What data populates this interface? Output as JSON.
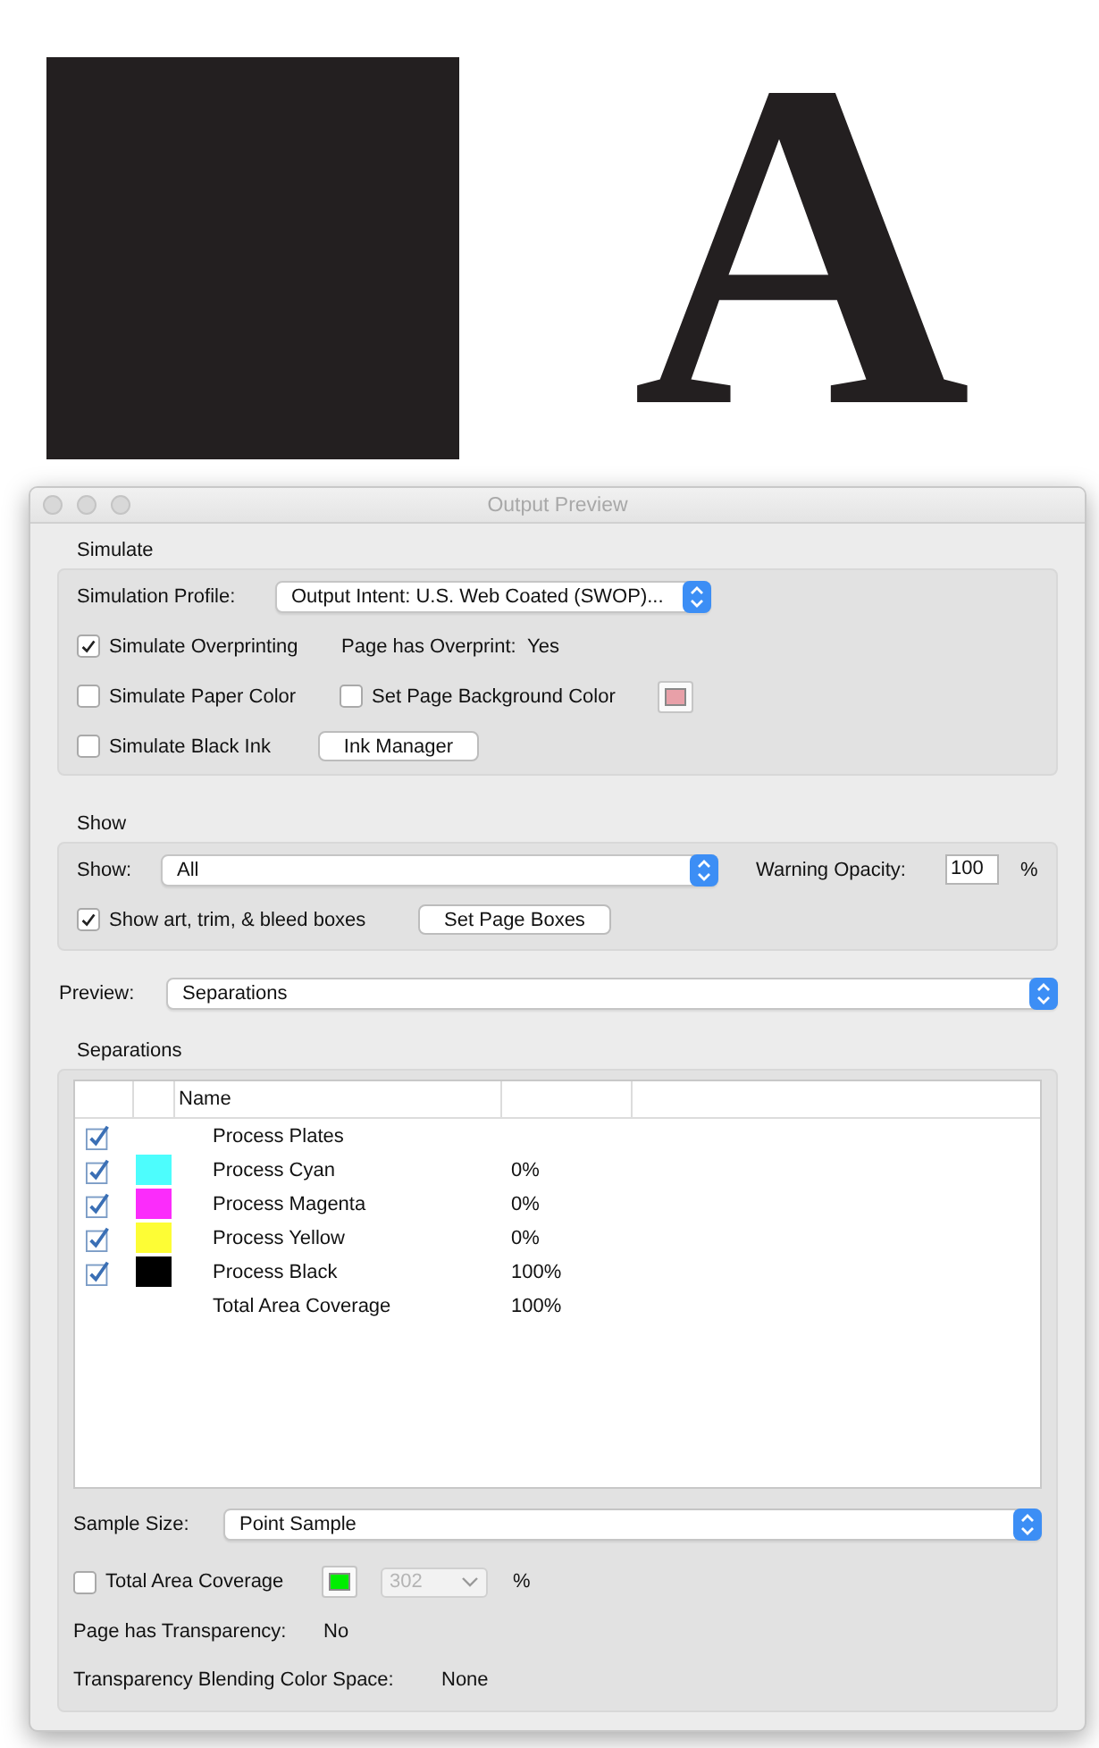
{
  "document": {
    "letter": "A"
  },
  "window": {
    "title": "Output Preview"
  },
  "simulate": {
    "label": "Simulate",
    "profile_label": "Simulation Profile:",
    "profile": "Output Intent: U.S. Web Coated (SWOP)...",
    "overprinting": {
      "label": "Simulate Overprinting",
      "checked": true
    },
    "overprint_label": "Page has Overprint:",
    "overprint_value": "Yes",
    "paper_color": {
      "label": "Simulate Paper Color",
      "checked": false
    },
    "page_background": {
      "label": "Set Page Background Color",
      "checked": false,
      "color": "#e8a0a8"
    },
    "black_ink": {
      "label": "Simulate Black Ink",
      "checked": false
    },
    "ink_manager_button": "Ink Manager"
  },
  "show": {
    "label": "Show",
    "show_label": "Show:",
    "show_value": "All",
    "opacity_label": "Warning Opacity:",
    "opacity_value": "100",
    "opacity_unit": "%",
    "boxes": {
      "label": "Show art, trim, & bleed boxes",
      "checked": true
    },
    "set_page_boxes_button": "Set Page Boxes"
  },
  "preview": {
    "label": "Preview:",
    "value": "Separations"
  },
  "separations": {
    "label": "Separations",
    "columns": [
      "Name"
    ],
    "rows": [
      {
        "kind": "plate",
        "name": "Process Plates",
        "checked": true
      },
      {
        "kind": "ink",
        "name": "Process Cyan",
        "checked": true,
        "color": "#4dfdfd",
        "coverage": "0%"
      },
      {
        "kind": "ink",
        "name": "Process Magenta",
        "checked": true,
        "color": "#fb2cfb",
        "coverage": "0%"
      },
      {
        "kind": "ink",
        "name": "Process Yellow",
        "checked": true,
        "color": "#fdfd35",
        "coverage": "0%"
      },
      {
        "kind": "ink",
        "name": "Process Black",
        "checked": true,
        "color": "#000000",
        "coverage": "100%"
      },
      {
        "kind": "total",
        "name": "Total Area Coverage",
        "coverage": "100%"
      }
    ],
    "sample_label": "Sample Size:",
    "sample_value": "Point Sample",
    "total_coverage": {
      "label": "Total Area Coverage",
      "checked": false,
      "color": "#00ee00",
      "value": "302",
      "disabled": true,
      "unit": "%"
    },
    "transparency_label": "Page has Transparency:",
    "transparency_value": "No",
    "blending_label": "Transparency Blending Color Space:",
    "blending_value": "None"
  }
}
